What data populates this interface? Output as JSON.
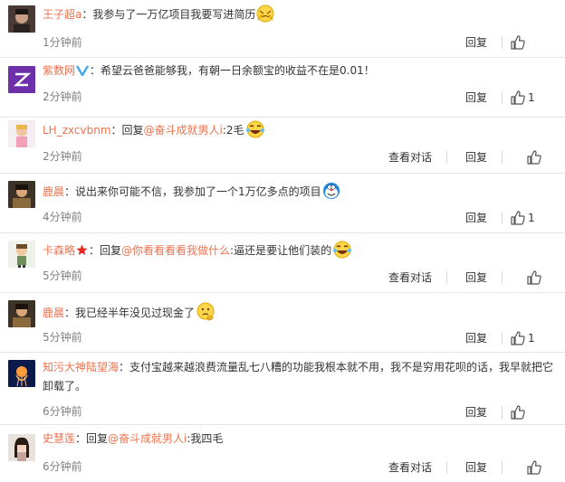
{
  "comments": [
    {
      "user": "王子超a",
      "parts": [
        {
          "t": "：我参与了一万亿项目我要写进简历"
        }
      ],
      "emoji": "aww-face-icon",
      "time": "1分钟前",
      "reply_label": "回复",
      "likes": ""
    },
    {
      "user": "紫数网",
      "badge": "verified-v",
      "parts": [
        {
          "t": "：希望云爸爸能够我，有朝一日余额宝的收益不在是0.01！"
        }
      ],
      "time": "2分钟前",
      "reply_label": "回复",
      "likes": "1"
    },
    {
      "user": "LH_zxcvbnm",
      "parts": [
        {
          "t": "：回复"
        },
        {
          "link": "@奋斗成就男人i"
        },
        {
          "t": ":2毛"
        }
      ],
      "emoji": "laughing-tears-icon",
      "time": "2分钟前",
      "view_label": "查看对话",
      "reply_label": "回复",
      "likes": ""
    },
    {
      "user": "鹿晨",
      "parts": [
        {
          "t": "：说出来你可能不信，我参加了一个1万亿多点的项目"
        }
      ],
      "emoji": "doraemon-icon",
      "time": "4分钟前",
      "reply_label": "回复",
      "likes": "1"
    },
    {
      "user": "卡森略",
      "badge": "red-star",
      "parts": [
        {
          "t": "：回复"
        },
        {
          "link": "@你看看看看我做什么"
        },
        {
          "t": ":逼还是要让他们装的"
        }
      ],
      "emoji": "laughing-tears-icon",
      "time": "5分钟前",
      "view_label": "查看对话",
      "reply_label": "回复",
      "likes": ""
    },
    {
      "user": "鹿晨",
      "parts": [
        {
          "t": "：我已经半年没见过现金了"
        }
      ],
      "emoji": "thinking-face-icon",
      "time": "5分钟前",
      "reply_label": "回复",
      "likes": "1"
    },
    {
      "user": "知污大神陆望海",
      "parts": [
        {
          "t": "：支付宝越来越浪费流量乱七八糟的功能我根本就不用，我不是穷用花呗的话，我早就把它卸载了。"
        }
      ],
      "time": "6分钟前",
      "reply_label": "回复",
      "likes": ""
    },
    {
      "user": "史慧莲",
      "parts": [
        {
          "t": "：回复"
        },
        {
          "link": "@奋斗成就男人i"
        },
        {
          "t": ":我四毛"
        }
      ],
      "time": "6分钟前",
      "view_label": "查看对话",
      "reply_label": "回复",
      "likes": ""
    }
  ]
}
